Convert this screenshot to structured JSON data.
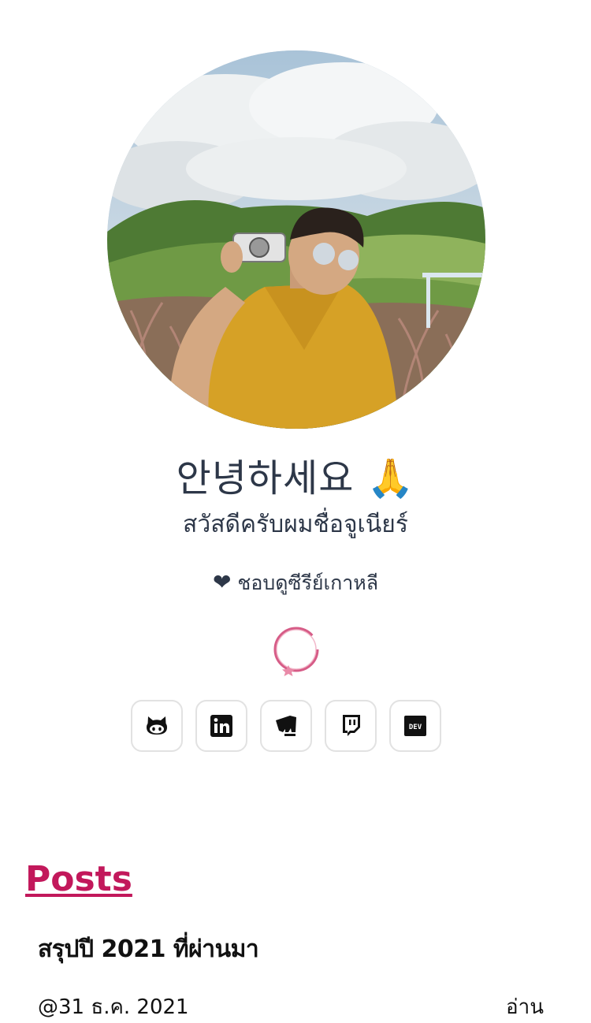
{
  "profile": {
    "avatar_alt": "profile-photo",
    "greeting": "안녕하세요 🙏",
    "subtitle": "สวัสดีครับผมชื่อจูเนียร์",
    "likes_icon": "heart-icon",
    "likes_text": "ชอบดูซีรีย์เกาหลี"
  },
  "socials": [
    {
      "name": "github",
      "icon": "github-icon"
    },
    {
      "name": "linkedin",
      "icon": "linkedin-icon"
    },
    {
      "name": "riot-games",
      "icon": "riot-games-icon"
    },
    {
      "name": "twitch",
      "icon": "twitch-icon"
    },
    {
      "name": "dev",
      "icon": "dev-icon"
    }
  ],
  "posts": {
    "heading": "Posts",
    "items": [
      {
        "title": "สรุปปี 2021 ที่ผ่านมา",
        "date": "@31 ธ.ค. 2021",
        "read_label": "อ่าน"
      }
    ]
  },
  "colors": {
    "accent": "#c2185b",
    "text": "#2d3748"
  }
}
